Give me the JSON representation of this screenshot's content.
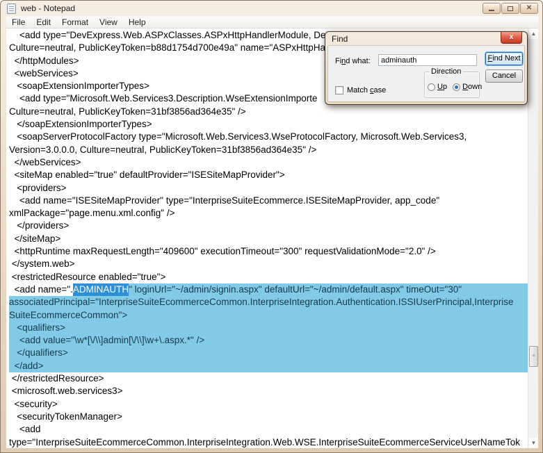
{
  "window": {
    "title": "web - Notepad",
    "menu_items": [
      "File",
      "Edit",
      "Format",
      "View",
      "Help"
    ],
    "controls": {
      "minimize": "minimize",
      "maximize": "maximize",
      "close": "close"
    }
  },
  "colors": {
    "selection_blue": "#2f8ed8",
    "highlight_blue": "#82cbe7",
    "frame_tan": "#ecdecb",
    "dialog_close_red": "#d8513a"
  },
  "editor": {
    "lines": [
      "    <add type=\"DevExpress.Web.ASPxClasses.ASPxHttpHandlerModule, Dev",
      "Culture=neutral, PublicKeyToken=b88d1754d700e49a\" name=\"ASPxHttpHa",
      "  </httpModules>",
      "  <webServices>",
      "   <soapExtensionImporterTypes>",
      "    <add type=\"Microsoft.Web.Services3.Description.WseExtensionImporte",
      "Culture=neutral, PublicKeyToken=31bf3856ad364e35\" />",
      "   </soapExtensionImporterTypes>",
      "   <soapServerProtocolFactory type=\"Microsoft.Web.Services3.WseProtocolFactory, Microsoft.Web.Services3,",
      "Version=3.0.0.0, Culture=neutral, PublicKeyToken=31bf3856ad364e35\" />",
      "  </webServices>",
      "  <siteMap enabled=\"true\" defaultProvider=\"ISESiteMapProvider\">",
      "   <providers>",
      "    <add name=\"ISESiteMapProvider\" type=\"InterpriseSuiteEcommerce.ISESiteMapProvider, app_code\"",
      "xmlPackage=\"page.menu.xml.config\" />",
      "   </providers>",
      "  </siteMap>",
      "  <httpRuntime maxRequestLength=\"409600\" executionTimeout=\"300\" requestValidationMode=\"2.0\" />",
      " </system.web>",
      " <restrictedResource enabled=\"true\">",
      {
        "fill": true,
        "segments": [
          {
            "text": "  <add name=\".",
            "style": "n"
          },
          {
            "text": "ADMINAUTH",
            "style": "sel"
          },
          {
            "text": "\" loginUrl=\"~/admin/signin.aspx\" defaultUrl=\"~/admin/default.aspx\" timeOut=\"30\"",
            "style": "hl"
          }
        ]
      },
      {
        "fill": true,
        "segments": [
          {
            "text": "associatedPrincipal=\"InterpriseSuiteEcommerceCommon.InterpriseIntegration.Authentication.ISSIUserPrincipal,Interprise",
            "style": "hl"
          }
        ]
      },
      {
        "fill": true,
        "segments": [
          {
            "text": "SuiteEcommerceCommon\">",
            "style": "hl"
          }
        ]
      },
      {
        "fill": true,
        "segments": [
          {
            "text": "   <qualifiers>",
            "style": "hl"
          }
        ]
      },
      {
        "fill": true,
        "segments": [
          {
            "text": "    <add value=\"\\w*[\\/\\\\]admin[\\/\\\\]\\w+\\.aspx.*\" />",
            "style": "hl"
          }
        ]
      },
      {
        "fill": true,
        "segments": [
          {
            "text": "   </qualifiers>",
            "style": "hl"
          }
        ]
      },
      {
        "fill": true,
        "segments": [
          {
            "text": "  </add>",
            "style": "hl"
          }
        ]
      },
      " </restrictedResource>",
      " <microsoft.web.services3>",
      "  <security>",
      "   <securityTokenManager>",
      "    <add",
      "type=\"InterpriseSuiteEcommerceCommon.InterpriseIntegration.Web.WSE.InterpriseSuiteEcommerceServiceUserNameTok"
    ]
  },
  "find_dialog": {
    "title": "Find",
    "close_glyph": "x",
    "find_what": {
      "label_pre": "Fi",
      "label_key": "n",
      "label_post": "d what:",
      "value": "adminauth"
    },
    "find_next": {
      "label_key": "F",
      "label_post": "ind Next"
    },
    "cancel_label": "Cancel",
    "direction": {
      "label": "Direction",
      "up_key": "U",
      "up_post": "p",
      "down_key": "D",
      "down_post": "own",
      "selected": "Down"
    },
    "match_case": {
      "label_pre": "Match ",
      "label_key": "c",
      "label_post": "ase",
      "checked": false
    }
  },
  "scrollbar": {
    "up_glyph": "▲",
    "down_glyph": "▼",
    "thumb_glyph": "≡"
  }
}
